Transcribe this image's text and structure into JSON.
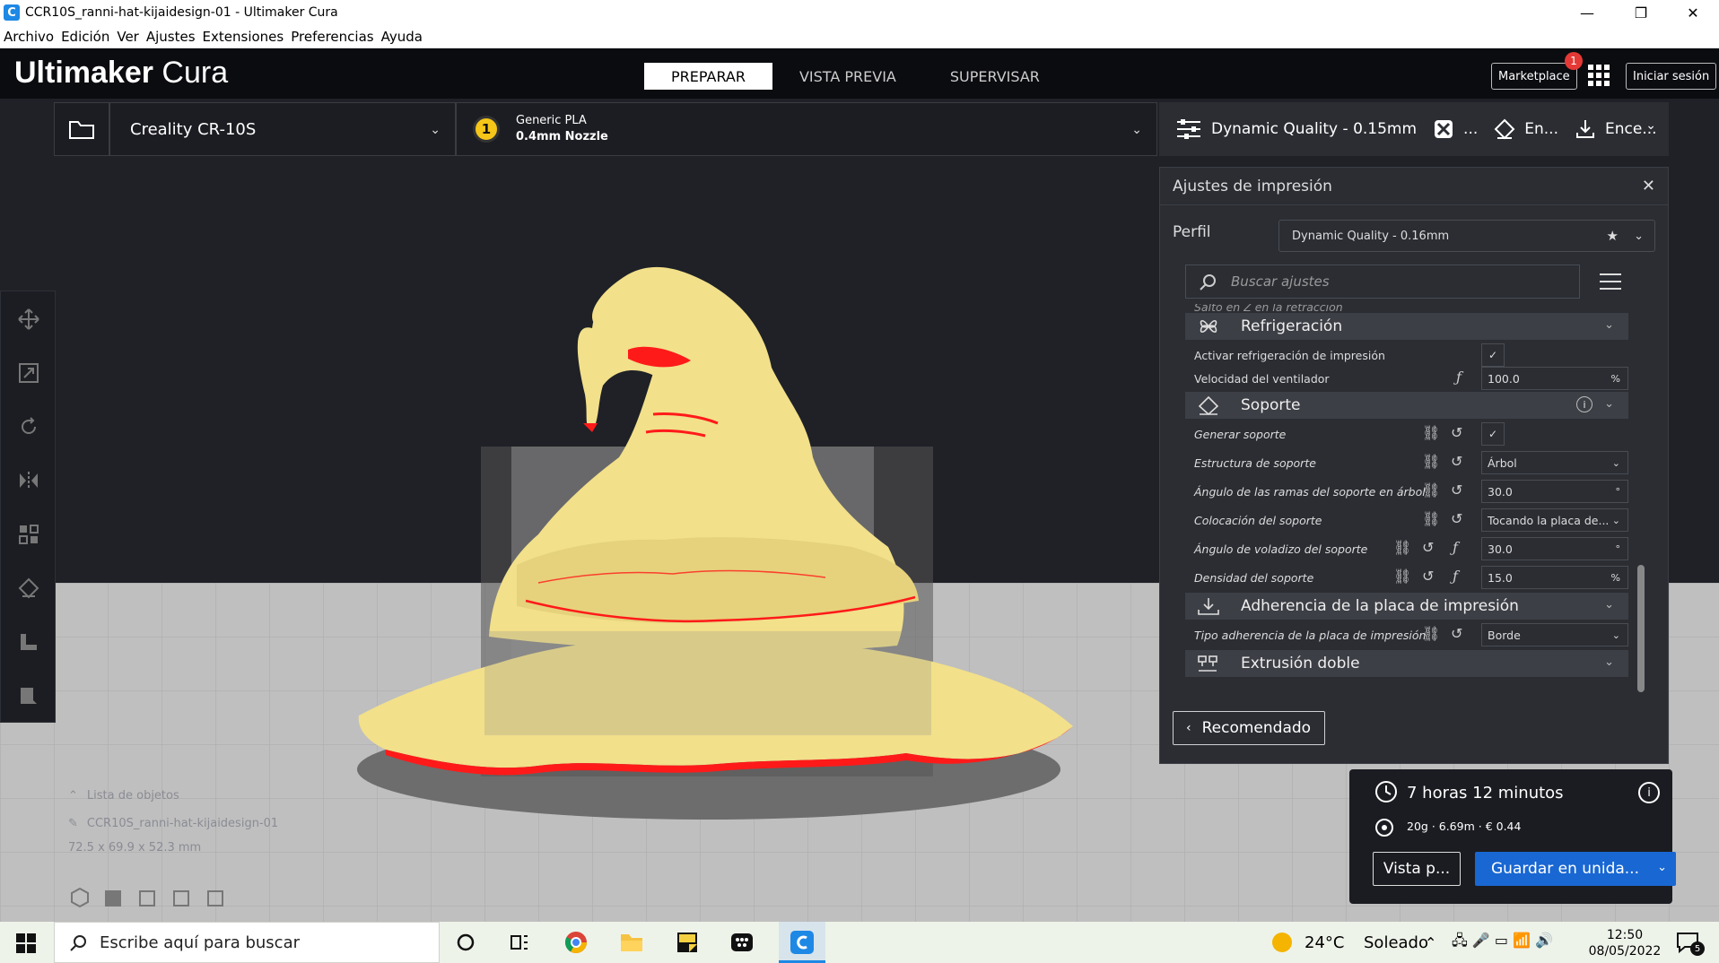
{
  "window": {
    "title": "CCR10S_ranni-hat-kijaidesign-01 - Ultimaker Cura",
    "app_icon": "C",
    "minimize": "—",
    "maximize": "❐",
    "close": "✕"
  },
  "menu": [
    "Archivo",
    "Edición",
    "Ver",
    "Ajustes",
    "Extensiones",
    "Preferencias",
    "Ayuda"
  ],
  "header": {
    "logo_bold": "Ultimaker",
    "logo_light": " Cura",
    "stages": [
      "PREPARAR",
      "VISTA PREVIA",
      "SUPERVISAR"
    ],
    "marketplace": "Marketplace",
    "marketplace_badge": "1",
    "login": "Iniciar sesión"
  },
  "printer_bar": {
    "printer": "Creality CR-10S",
    "extruder_number": "1",
    "material": "Generic PLA",
    "nozzle": "0.4mm Nozzle"
  },
  "profile_bar": {
    "quality": "Dynamic Quality - 0.15mm",
    "support": "...",
    "adhesion": "En...",
    "cooling": "Ence..."
  },
  "panel": {
    "title": "Ajustes de impresión",
    "close": "✕",
    "perfil_label": "Perfil",
    "perfil_value": "Dynamic Quality - 0.16mm",
    "search_placeholder": "Buscar ajustes",
    "partial_row": "Salto en Z en la retracción",
    "categories": {
      "cooling": "Refrigeración",
      "support": "Soporte",
      "adhesion": "Adherencia de la placa de impresión",
      "dual": "Extrusión doble"
    },
    "rows": {
      "cooling_enable": "Activar refrigeración de impresión",
      "fan_speed": "Velocidad del ventilador",
      "fan_speed_value": "100.0",
      "fan_speed_unit": "%",
      "gen_support": "Generar soporte",
      "support_structure": "Estructura de soporte",
      "support_structure_value": "Árbol",
      "tree_angle": "Ángulo de las ramas del soporte en árbol",
      "tree_angle_value": "30.0",
      "tree_angle_unit": "°",
      "placement": "Colocación del soporte",
      "placement_value": "Tocando la placa de...",
      "overhang": "Ángulo de voladizo del soporte",
      "overhang_value": "30.0",
      "overhang_unit": "°",
      "density": "Densidad del soporte",
      "density_value": "15.0",
      "density_unit": "%",
      "adhesion_type": "Tipo adherencia de la placa de impresión",
      "adhesion_type_value": "Borde"
    },
    "recommended": "Recomendado"
  },
  "object_list": {
    "title": "Lista de objetos",
    "object": "CCR10S_ranni-hat-kijaidesign-01",
    "dims": "72.5 x 69.9 x 52.3 mm"
  },
  "estimate": {
    "time": "7 horas 12 minutos",
    "material": "20g · 6.69m · € 0.44",
    "preview_btn": "Vista p...",
    "save_btn": "Guardar en unida..."
  },
  "taskbar": {
    "search": "Escribe aquí para buscar",
    "temp": "24°C",
    "weather": "Soleado",
    "time": "12:50",
    "date": "08/05/2022",
    "notifications": "5"
  },
  "colors": {
    "accent": "#1967d2",
    "model": "#f2e08a",
    "overhang": "#ff1a1a"
  }
}
